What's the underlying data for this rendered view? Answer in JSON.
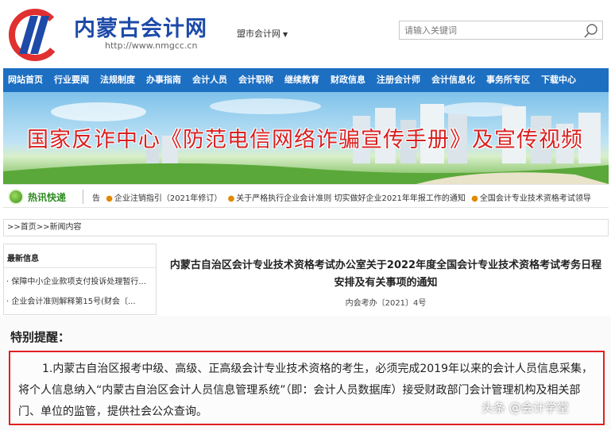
{
  "header": {
    "site_name": "内蒙古会计网",
    "site_url": "http://www.nmgcc.cn",
    "region_select": "盟市会计网",
    "search_placeholder": "请输入关键词"
  },
  "nav": {
    "items": [
      "网站首页",
      "行业要闻",
      "法规制度",
      "办事指南",
      "会计人员",
      "会计职称",
      "继续教育",
      "财政信息",
      "注册会计师",
      "会计信息化",
      "事务所专区",
      "下载中心"
    ]
  },
  "banner": {
    "title": "国家反诈中心《防范电信网络诈骗宣传手册》及宣传视频"
  },
  "hotnews": {
    "label": "热讯快递",
    "prefix": "告",
    "items": [
      "企业注销指引（2021年修订）",
      "关于严格执行企业会计准则 切实做好企业2021年年报工作的通知",
      "全国会计专业技术资格考试领导"
    ]
  },
  "breadcrumb": ">>首页>>新闻内容",
  "sidebar": {
    "title": "最新信息",
    "items": [
      "· 保障中小企业款项支付投诉处理暂行...",
      "· 企业会计准则解释第15号(财会〔..."
    ]
  },
  "article": {
    "title_line1": "内蒙古自治区会计专业技术资格考试办公室关于2022年度全国会计专业技术资格考试考务日程",
    "title_line2": "安排及有关事项的通知",
    "doc_number": "内会考办〔2021〕4号"
  },
  "notice": {
    "heading": "特别提醒：",
    "body": "1.内蒙古自治区报考中级、高级、正高级会计专业技术资格的考生，必须完成2019年以来的会计人员信息采集，将个人信息纳入“内蒙古自治区会计人员信息管理系统”（即：会计人员数据库）接受财政部门会计管理机构及相关部门、单位的监管，提供社会公众查询。"
  },
  "watermark": "头条 @会计学堂",
  "colors": {
    "nav_blue": "#1d6fc2",
    "brand_red": "#d92020",
    "brand_blue": "#1e4aa8",
    "highlight_border": "#e02020",
    "hot_green": "#2b8b1e"
  },
  "icons": [
    "logo-icon",
    "search-icon",
    "chevron-down-icon",
    "hot-news-icon"
  ]
}
